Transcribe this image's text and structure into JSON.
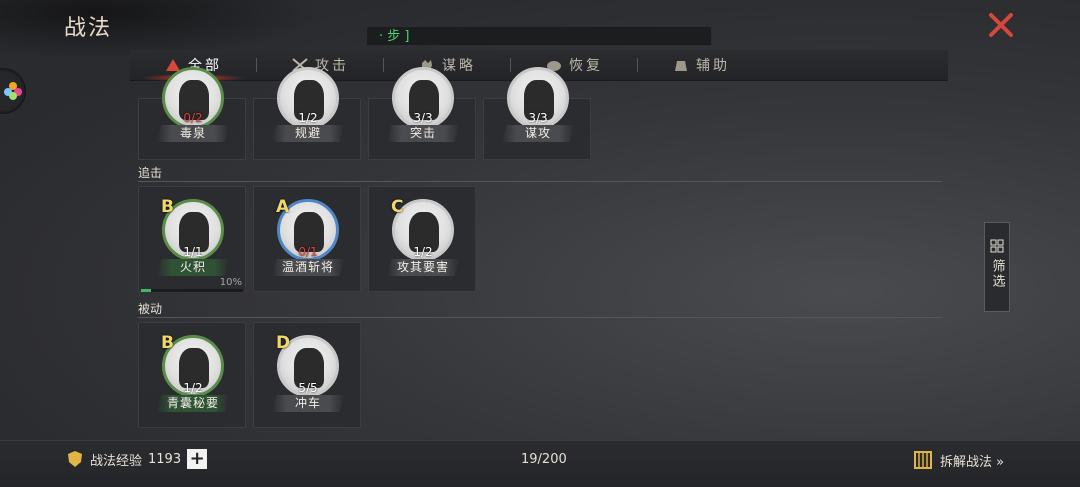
{
  "header": {
    "title": "战法",
    "search_value": "· 步 ]"
  },
  "tabs": [
    {
      "label": "全部",
      "icon": "all-skills-icon"
    },
    {
      "label": "攻击",
      "icon": "crossed-swords-icon"
    },
    {
      "label": "谋略",
      "icon": "hand-strategy-icon"
    },
    {
      "label": "恢复",
      "icon": "recovery-icon"
    },
    {
      "label": "辅助",
      "icon": "support-bag-icon"
    }
  ],
  "sections": {
    "top_cards": [
      {
        "name": "毒泉",
        "count": "0/2",
        "count_red": true
      },
      {
        "name": "规避",
        "count": "1/2"
      },
      {
        "name": "突击",
        "count": "3/3"
      },
      {
        "name": "谋攻",
        "count": "3/3"
      }
    ],
    "pursuit": {
      "label": "追击",
      "cards": [
        {
          "grade": "B",
          "name": "火积",
          "count": "1/1",
          "progress_pct": "10%"
        },
        {
          "grade": "A",
          "name": "温酒斩将",
          "count": "0/1",
          "count_red": true
        },
        {
          "grade": "C",
          "name": "攻其要害",
          "count": "1/2"
        }
      ]
    },
    "passive": {
      "label": "被动",
      "cards": [
        {
          "grade": "B",
          "name": "青囊秘要",
          "count": "1/2"
        },
        {
          "grade": "D",
          "name": "冲车",
          "count": "5/5"
        }
      ]
    }
  },
  "filter": {
    "label": "筛选"
  },
  "footer": {
    "exp_label": "战法经验",
    "exp_value": "1193",
    "plus": "+",
    "page_count": "19/200",
    "dismantle_label": "拆解战法 »"
  },
  "colors": {
    "accent_red": "#d9463a",
    "grade_gold": "#f1d86a",
    "search_green": "#4fd36d"
  }
}
